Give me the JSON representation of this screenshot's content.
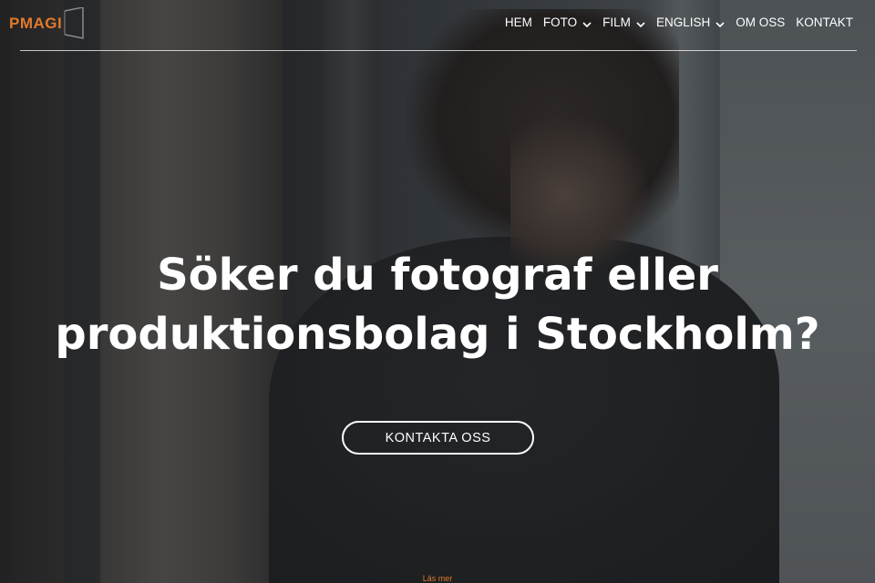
{
  "brand": {
    "logo_text": "PMAGI",
    "accent_color": "#e07a2c"
  },
  "nav": {
    "items": [
      {
        "label": "HEM",
        "has_dropdown": false
      },
      {
        "label": "FOTO",
        "has_dropdown": true
      },
      {
        "label": "FILM",
        "has_dropdown": true
      },
      {
        "label": "ENGLISH",
        "has_dropdown": true
      },
      {
        "label": "OM OSS",
        "has_dropdown": false
      },
      {
        "label": "KONTAKT",
        "has_dropdown": false
      }
    ],
    "dropdown_icon": "chevron-down-icon"
  },
  "hero": {
    "headline_line1": "Söker du fotograf eller",
    "headline_line2": "produktionsbolag i Stockholm?",
    "cta_label": "KONTAKTA OSS",
    "read_more_label": "Läs mer"
  }
}
